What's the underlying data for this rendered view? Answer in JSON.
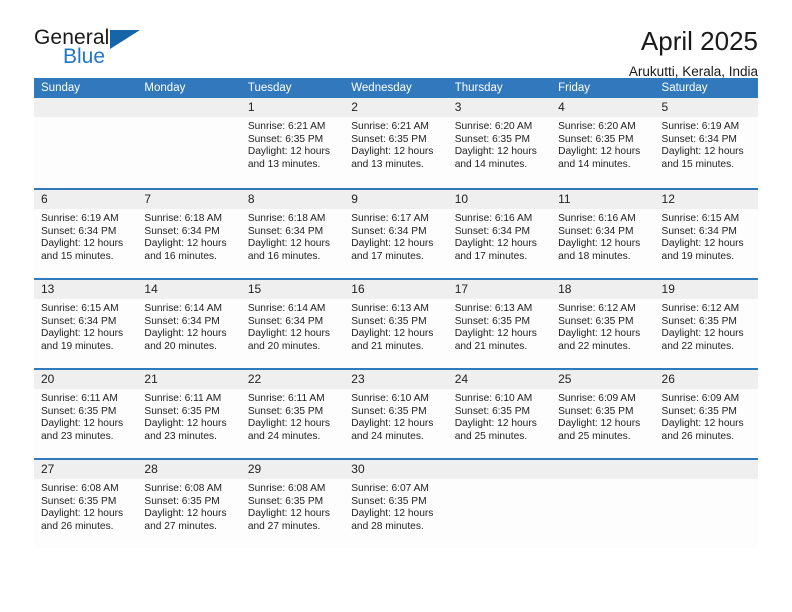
{
  "logo": {
    "word_one": "General",
    "word_two": "Blue",
    "flag_icon": "blue-triangle-flag-icon",
    "brand_color": "#1565a8",
    "accent_color": "#2277c8"
  },
  "header": {
    "title": "April 2025",
    "subtitle": "Arukutti, Kerala, India"
  },
  "calendar": {
    "header_bg": "#3179bc",
    "row_rule_color": "#3179bc",
    "day_band_bg": "#efefef",
    "weekday_headers": [
      "Sunday",
      "Monday",
      "Tuesday",
      "Wednesday",
      "Thursday",
      "Friday",
      "Saturday"
    ],
    "weeks": [
      [
        {
          "day": "",
          "empty": true
        },
        {
          "day": "",
          "empty": true
        },
        {
          "day": "1",
          "sunrise": "Sunrise: 6:21 AM",
          "sunset": "Sunset: 6:35 PM",
          "daylight": "Daylight: 12 hours and 13 minutes."
        },
        {
          "day": "2",
          "sunrise": "Sunrise: 6:21 AM",
          "sunset": "Sunset: 6:35 PM",
          "daylight": "Daylight: 12 hours and 13 minutes."
        },
        {
          "day": "3",
          "sunrise": "Sunrise: 6:20 AM",
          "sunset": "Sunset: 6:35 PM",
          "daylight": "Daylight: 12 hours and 14 minutes."
        },
        {
          "day": "4",
          "sunrise": "Sunrise: 6:20 AM",
          "sunset": "Sunset: 6:35 PM",
          "daylight": "Daylight: 12 hours and 14 minutes."
        },
        {
          "day": "5",
          "sunrise": "Sunrise: 6:19 AM",
          "sunset": "Sunset: 6:34 PM",
          "daylight": "Daylight: 12 hours and 15 minutes."
        }
      ],
      [
        {
          "day": "6",
          "sunrise": "Sunrise: 6:19 AM",
          "sunset": "Sunset: 6:34 PM",
          "daylight": "Daylight: 12 hours and 15 minutes."
        },
        {
          "day": "7",
          "sunrise": "Sunrise: 6:18 AM",
          "sunset": "Sunset: 6:34 PM",
          "daylight": "Daylight: 12 hours and 16 minutes."
        },
        {
          "day": "8",
          "sunrise": "Sunrise: 6:18 AM",
          "sunset": "Sunset: 6:34 PM",
          "daylight": "Daylight: 12 hours and 16 minutes."
        },
        {
          "day": "9",
          "sunrise": "Sunrise: 6:17 AM",
          "sunset": "Sunset: 6:34 PM",
          "daylight": "Daylight: 12 hours and 17 minutes."
        },
        {
          "day": "10",
          "sunrise": "Sunrise: 6:16 AM",
          "sunset": "Sunset: 6:34 PM",
          "daylight": "Daylight: 12 hours and 17 minutes."
        },
        {
          "day": "11",
          "sunrise": "Sunrise: 6:16 AM",
          "sunset": "Sunset: 6:34 PM",
          "daylight": "Daylight: 12 hours and 18 minutes."
        },
        {
          "day": "12",
          "sunrise": "Sunrise: 6:15 AM",
          "sunset": "Sunset: 6:34 PM",
          "daylight": "Daylight: 12 hours and 19 minutes."
        }
      ],
      [
        {
          "day": "13",
          "sunrise": "Sunrise: 6:15 AM",
          "sunset": "Sunset: 6:34 PM",
          "daylight": "Daylight: 12 hours and 19 minutes."
        },
        {
          "day": "14",
          "sunrise": "Sunrise: 6:14 AM",
          "sunset": "Sunset: 6:34 PM",
          "daylight": "Daylight: 12 hours and 20 minutes."
        },
        {
          "day": "15",
          "sunrise": "Sunrise: 6:14 AM",
          "sunset": "Sunset: 6:34 PM",
          "daylight": "Daylight: 12 hours and 20 minutes."
        },
        {
          "day": "16",
          "sunrise": "Sunrise: 6:13 AM",
          "sunset": "Sunset: 6:35 PM",
          "daylight": "Daylight: 12 hours and 21 minutes."
        },
        {
          "day": "17",
          "sunrise": "Sunrise: 6:13 AM",
          "sunset": "Sunset: 6:35 PM",
          "daylight": "Daylight: 12 hours and 21 minutes."
        },
        {
          "day": "18",
          "sunrise": "Sunrise: 6:12 AM",
          "sunset": "Sunset: 6:35 PM",
          "daylight": "Daylight: 12 hours and 22 minutes."
        },
        {
          "day": "19",
          "sunrise": "Sunrise: 6:12 AM",
          "sunset": "Sunset: 6:35 PM",
          "daylight": "Daylight: 12 hours and 22 minutes."
        }
      ],
      [
        {
          "day": "20",
          "sunrise": "Sunrise: 6:11 AM",
          "sunset": "Sunset: 6:35 PM",
          "daylight": "Daylight: 12 hours and 23 minutes."
        },
        {
          "day": "21",
          "sunrise": "Sunrise: 6:11 AM",
          "sunset": "Sunset: 6:35 PM",
          "daylight": "Daylight: 12 hours and 23 minutes."
        },
        {
          "day": "22",
          "sunrise": "Sunrise: 6:11 AM",
          "sunset": "Sunset: 6:35 PM",
          "daylight": "Daylight: 12 hours and 24 minutes."
        },
        {
          "day": "23",
          "sunrise": "Sunrise: 6:10 AM",
          "sunset": "Sunset: 6:35 PM",
          "daylight": "Daylight: 12 hours and 24 minutes."
        },
        {
          "day": "24",
          "sunrise": "Sunrise: 6:10 AM",
          "sunset": "Sunset: 6:35 PM",
          "daylight": "Daylight: 12 hours and 25 minutes."
        },
        {
          "day": "25",
          "sunrise": "Sunrise: 6:09 AM",
          "sunset": "Sunset: 6:35 PM",
          "daylight": "Daylight: 12 hours and 25 minutes."
        },
        {
          "day": "26",
          "sunrise": "Sunrise: 6:09 AM",
          "sunset": "Sunset: 6:35 PM",
          "daylight": "Daylight: 12 hours and 26 minutes."
        }
      ],
      [
        {
          "day": "27",
          "sunrise": "Sunrise: 6:08 AM",
          "sunset": "Sunset: 6:35 PM",
          "daylight": "Daylight: 12 hours and 26 minutes."
        },
        {
          "day": "28",
          "sunrise": "Sunrise: 6:08 AM",
          "sunset": "Sunset: 6:35 PM",
          "daylight": "Daylight: 12 hours and 27 minutes."
        },
        {
          "day": "29",
          "sunrise": "Sunrise: 6:08 AM",
          "sunset": "Sunset: 6:35 PM",
          "daylight": "Daylight: 12 hours and 27 minutes."
        },
        {
          "day": "30",
          "sunrise": "Sunrise: 6:07 AM",
          "sunset": "Sunset: 6:35 PM",
          "daylight": "Daylight: 12 hours and 28 minutes."
        },
        {
          "day": "",
          "empty": true
        },
        {
          "day": "",
          "empty": true
        },
        {
          "day": "",
          "empty": true
        }
      ]
    ]
  }
}
